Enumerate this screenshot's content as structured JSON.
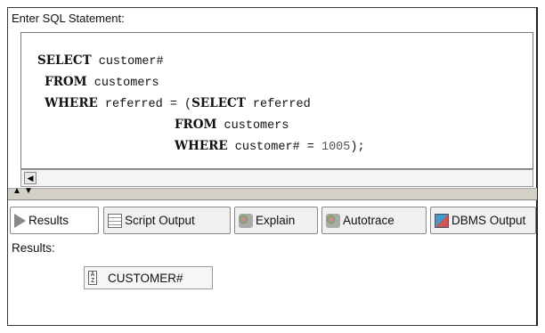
{
  "sql_panel": {
    "label": "Enter SQL Statement:",
    "lines": [
      [
        {
          "kw": "SELECT"
        },
        {
          "t": " customer#"
        }
      ],
      [
        {
          "kw": "FROM"
        },
        {
          "t": " customers"
        }
      ],
      [
        {
          "kw": "WHERE"
        },
        {
          "t": " referred = (",
          "keep": true
        },
        {
          "kw": "SELECT"
        },
        {
          "t": " referred"
        }
      ],
      [
        {
          "kw": "FROM"
        },
        {
          "t": " customers"
        }
      ],
      [
        {
          "kw": "WHERE"
        },
        {
          "t": " customer# = "
        },
        {
          "num": "1005"
        },
        {
          "t": ");"
        }
      ]
    ],
    "indents": [
      "",
      " ",
      " ",
      "                   ",
      "                   "
    ]
  },
  "tabs": [
    {
      "label": "Results",
      "icon": "play-triangle-icon",
      "active": true
    },
    {
      "label": "Script Output",
      "icon": "script-document-icon",
      "active": false
    },
    {
      "label": "Explain",
      "icon": "explain-plan-icon",
      "active": false
    },
    {
      "label": "Autotrace",
      "icon": "autotrace-icon",
      "active": false
    },
    {
      "label": "DBMS Output",
      "icon": "dbms-output-icon",
      "active": false
    }
  ],
  "results": {
    "label": "Results:",
    "columns": [
      "CUSTOMER#"
    ],
    "sort_icon_text": "A Z"
  },
  "scroll": {
    "left_arrow": "◀"
  },
  "splitter": {
    "up": "▲",
    "down": "▼"
  }
}
